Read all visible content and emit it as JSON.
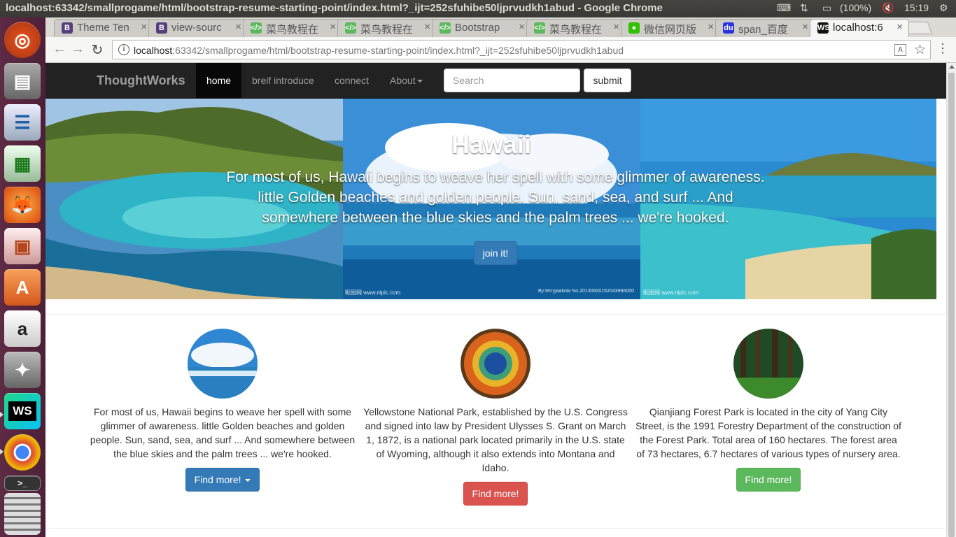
{
  "os": {
    "window_title": "localhost:63342/smallprogame/html/bootstrap-resume-starting-point/index.html?_ijt=252sfuhibe50ljprvudkh1abud - Google Chrome",
    "battery": "(100%)",
    "clock": "15:19"
  },
  "launcher": {
    "items": [
      "ubuntu-dash-icon",
      "files-icon",
      "writer-icon",
      "calc-icon",
      "firefox-icon",
      "impress-icon",
      "software-center-icon",
      "amazon-icon",
      "system-settings-icon",
      "webstorm-icon",
      "chrome-icon",
      "terminal-icon",
      "workspaces-icon"
    ],
    "amazon_glyph": "a",
    "webstorm_glyph": "WS",
    "terminal_glyph": ">_"
  },
  "browser": {
    "tabs": [
      {
        "label": "Theme Ten",
        "favicon": "B",
        "color": "#563d7c"
      },
      {
        "label": "view-sourc",
        "favicon": "B",
        "color": "#563d7c"
      },
      {
        "label": "菜鸟教程在",
        "favicon": "</>",
        "color": "#5cb85c"
      },
      {
        "label": "菜鸟教程在",
        "favicon": "</>",
        "color": "#5cb85c"
      },
      {
        "label": "Bootstrap",
        "favicon": "</>",
        "color": "#5cb85c"
      },
      {
        "label": "菜鸟教程在",
        "favicon": "</>",
        "color": "#5cb85c"
      },
      {
        "label": "微信网页版",
        "favicon": "●",
        "color": "#2dc100"
      },
      {
        "label": "span_百度",
        "favicon": "du",
        "color": "#2932e1"
      },
      {
        "label": "localhost:6",
        "favicon": "WS",
        "color": "#111111"
      }
    ],
    "tab_close": "×",
    "url_host": "localhost",
    "url_rest": ":63342/smallprogame/html/bootstrap-resume-starting-point/index.html?_ijt=252sfuhibe50ljprvudkh1abud"
  },
  "site": {
    "brand": "ThoughtWorks",
    "nav": {
      "home": "home",
      "intro": "breif introduce",
      "connect": "connect",
      "about": "About"
    },
    "search_placeholder": "Search",
    "submit_label": "submit",
    "hero": {
      "title": "Hawaii",
      "lead": "For most of us, Hawaii begins to weave her spell with some glimmer of awareness. little Golden beaches and golden people. Sun, sand, sea, and surf ... And somewhere between the blue skies and the palm trees ... we're hooked.",
      "button": "join it!",
      "watermark_left": "昵图网 www.nipic.com",
      "watermark_mid": "By:ferryjaakola No.20130920152043966000",
      "watermark_right": "昵图网 www.nipic.com"
    },
    "features": [
      {
        "text": "For most of us, Hawaii begins to weave her spell with some glimmer of awareness. little Golden beaches and golden people. Sun, sand, sea, and surf ... And somewhere between the blue skies and the palm trees ... we're hooked.",
        "button": "Find more!",
        "color": "#337ab7"
      },
      {
        "text": "Yellowstone National Park, established by the U.S. Congress and signed into law by President Ulysses S. Grant on March 1, 1872, is a national park located primarily in the U.S. state of Wyoming, although it also extends into Montana and Idaho.",
        "button": "Find more!",
        "color": "#d9534f"
      },
      {
        "text": "Qianjiang Forest Park is located in the city of Yang City Street, is the 1991 Forestry Department of the construction of the Forest Park. Total area of 160 hectares. The forest area of 73 hectares, 6.7 hectares of various types of nursery area.",
        "button": "Find more!",
        "color": "#5cb85c"
      }
    ]
  }
}
